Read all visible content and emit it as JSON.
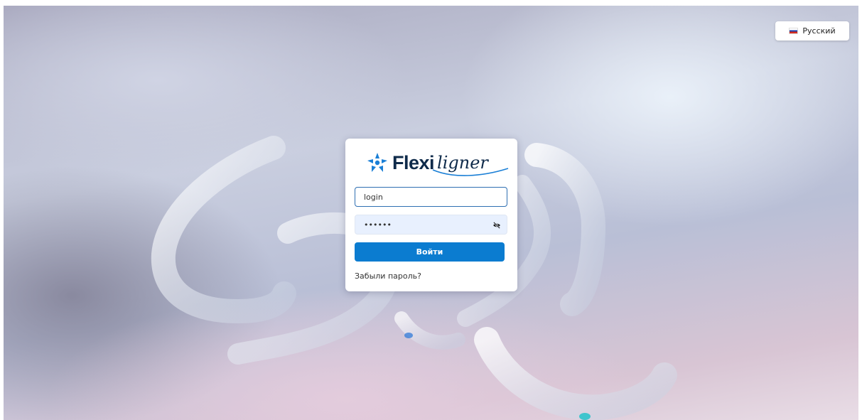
{
  "language": {
    "label": "Русский",
    "flag": "russia-flag"
  },
  "brand": {
    "name_part1": "Flexi",
    "name_part2": "ligner",
    "color": "#0e2a4a",
    "mark_color": "#1a7fd6"
  },
  "login_form": {
    "login_value": "login",
    "password_value": "••••••",
    "password_toggle_icon": "eye-off-icon",
    "submit_label": "Войти",
    "submit_color": "#0b7cd0",
    "forgot_label": "Забыли пароль?"
  }
}
